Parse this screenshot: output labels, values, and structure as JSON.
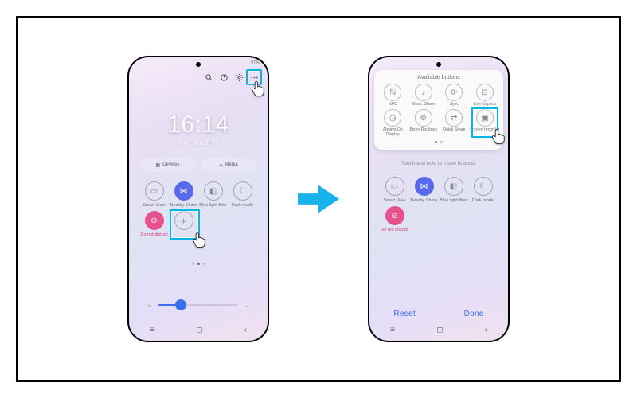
{
  "statusbar_text": "97%",
  "clock": {
    "time": "16:14",
    "date": "Tue, March 23"
  },
  "top_icons": [
    {
      "name": "search-icon"
    },
    {
      "name": "power-icon"
    },
    {
      "name": "gear-icon"
    },
    {
      "name": "more-icon"
    }
  ],
  "mid_buttons": {
    "devices": "Devices",
    "media": "Media"
  },
  "quick_settings_row1": [
    {
      "id": "smart-view",
      "label": "Smart View"
    },
    {
      "id": "nearby-share",
      "label": "Nearby Share"
    },
    {
      "id": "blue-light",
      "label": "Blue light filter"
    },
    {
      "id": "dark-mode",
      "label": "Dark mode"
    }
  ],
  "quick_settings_row2": [
    {
      "id": "dnd",
      "label": "Do not disturb"
    },
    {
      "id": "add",
      "label": ""
    }
  ],
  "brightness_percent": 28,
  "right_panel_title": "Available buttons",
  "right_panel_row1": [
    {
      "id": "nfc",
      "label": "NFC"
    },
    {
      "id": "music-share",
      "label": "Music Share"
    },
    {
      "id": "sync",
      "label": "Sync"
    },
    {
      "id": "live-caption",
      "label": "Live Caption"
    }
  ],
  "right_panel_row2": [
    {
      "id": "aod",
      "label": "Always On Display"
    },
    {
      "id": "bixby",
      "label": "Bixby Routines"
    },
    {
      "id": "quick-share",
      "label": "Quick Share"
    },
    {
      "id": "screen-recorder",
      "label": "Screen recorder"
    }
  ],
  "right_hint": "Touch and hold to move buttons.",
  "footer": {
    "reset": "Reset",
    "done": "Done"
  },
  "highlight": {
    "left_target": "more-icon",
    "right_target": "screen-recorder"
  }
}
